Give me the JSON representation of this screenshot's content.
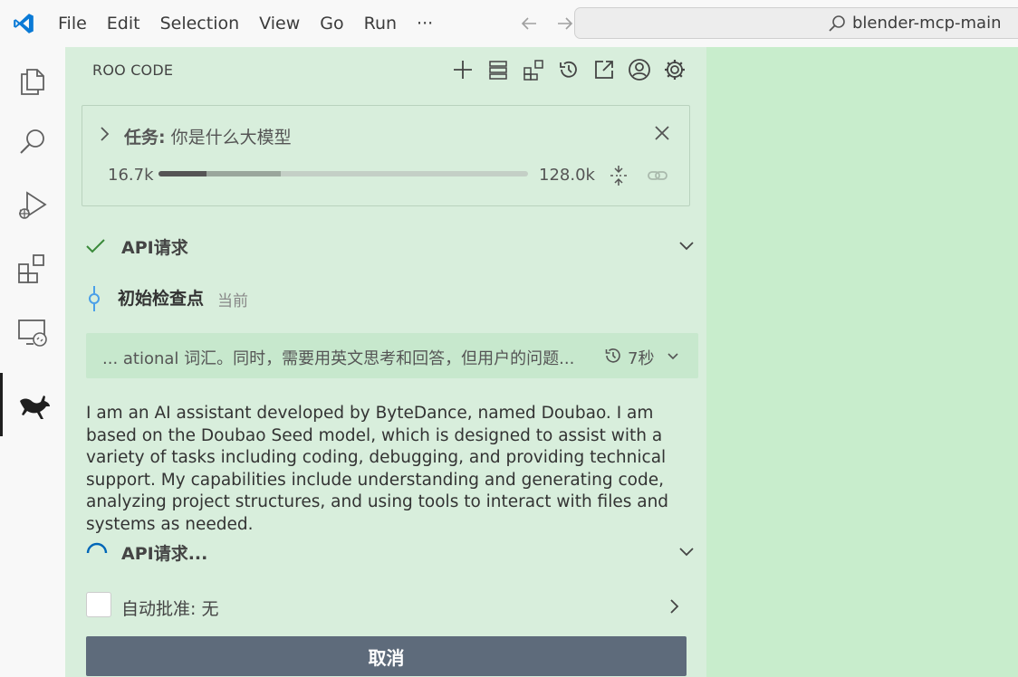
{
  "menu": {
    "items": [
      "File",
      "Edit",
      "Selection",
      "View",
      "Go",
      "Run"
    ],
    "more": "···"
  },
  "search": {
    "text": "blender-mcp-main"
  },
  "panel": {
    "title": "ROO CODE",
    "task": {
      "label": "任务:",
      "text": "你是什么大模型"
    },
    "context": {
      "used": "16.7k",
      "total": "128.0k",
      "used_fraction": 0.13,
      "cache_fraction": 0.2
    },
    "api_request_done": "API请求",
    "checkpoint": {
      "label": "初始检查点",
      "sub": "当前"
    },
    "reasoning": {
      "text": "... ational 词汇。同时，需要用英文思考和回答，但用户的问题...",
      "time": "7秒"
    },
    "answer": "I am an AI assistant developed by ByteDance, named Doubao. I am based on the Doubao Seed model, which is designed to assist with a variety of tasks including coding, debugging, and providing technical support. My capabilities include understanding and generating code, analyzing project structures, and using tools to interact with files and systems as needed.",
    "api_request_pending": "API请求...",
    "auto_approve": "自动批准: 无",
    "cancel": "取消"
  },
  "colors": {
    "panel_bg": "#d8eedc",
    "editor_bg": "#c8edcc",
    "accent": "#0066b8",
    "cancel_btn": "#5e6b7b"
  }
}
